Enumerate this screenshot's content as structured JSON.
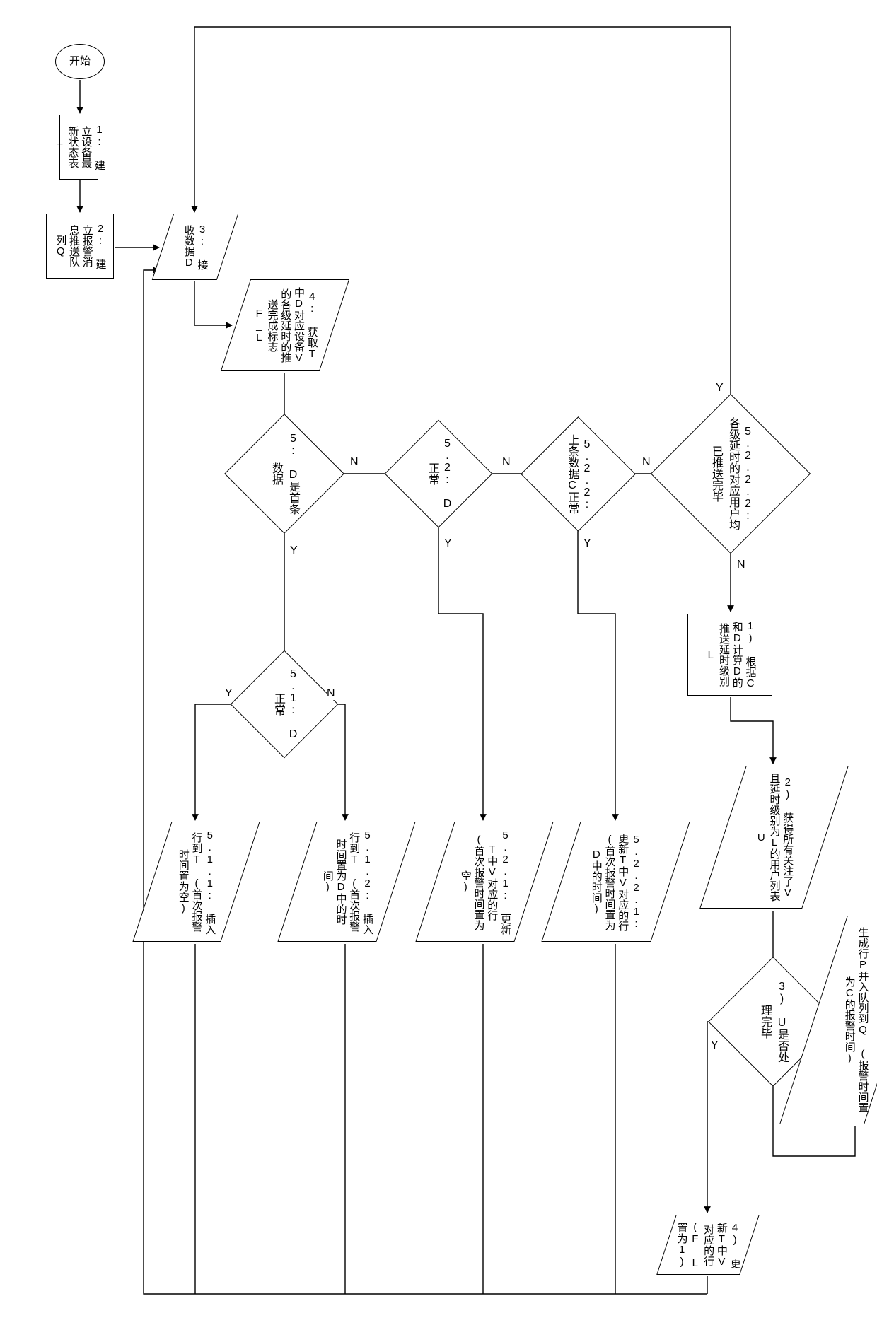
{
  "start": {
    "label": "开始"
  },
  "steps": {
    "s1": {
      "label": "1: 建立设备最新状态表T"
    },
    "s2": {
      "label": "2: 建立报警消息推送队列Q"
    },
    "s3": {
      "label": "3: 接收数据D"
    },
    "s4": {
      "label": "4: 获取T中D对应设备V的各级延时的推送完成标志F_L"
    },
    "d5": {
      "label": "5: D是首条数据"
    },
    "d51": {
      "label": "5.1: D正常"
    },
    "p511": {
      "label": "5.1.1: 插入行到T (首次报警时间置为空)"
    },
    "p512": {
      "label": "5.1.2: 插入行到T (首次报警时间置为D中的时间)"
    },
    "d52": {
      "label": "5.2: D正常"
    },
    "p521": {
      "label": "5.2.1: 更新T中V对应的行 (首次报警时间置为空)"
    },
    "d522": {
      "label": "5.2.2: 上条数据C正常"
    },
    "p5221": {
      "label": "5.2.2.1: 更新T中V对应的行 (首次报警时间置为D中的时间)"
    },
    "d5222": {
      "label": "5.2.2.2: 各级延时的对应用户均已推送完毕"
    },
    "step_calc": {
      "label": "1) 根据C和D计算D的推送延时级别L"
    },
    "step_users": {
      "label": "2) 获得所有关注了V且延时级别为L的用户列表U"
    },
    "d_users": {
      "label": "3) U是否处理完毕"
    },
    "step_enq": {
      "label": "生成行P并入队列到Q (报警时间置为C的报警时间)"
    },
    "step_updF": {
      "label": "4) 更新T中V对应的行 (F_L置为1)"
    }
  },
  "edges": {
    "y": "Y",
    "n": "N"
  }
}
